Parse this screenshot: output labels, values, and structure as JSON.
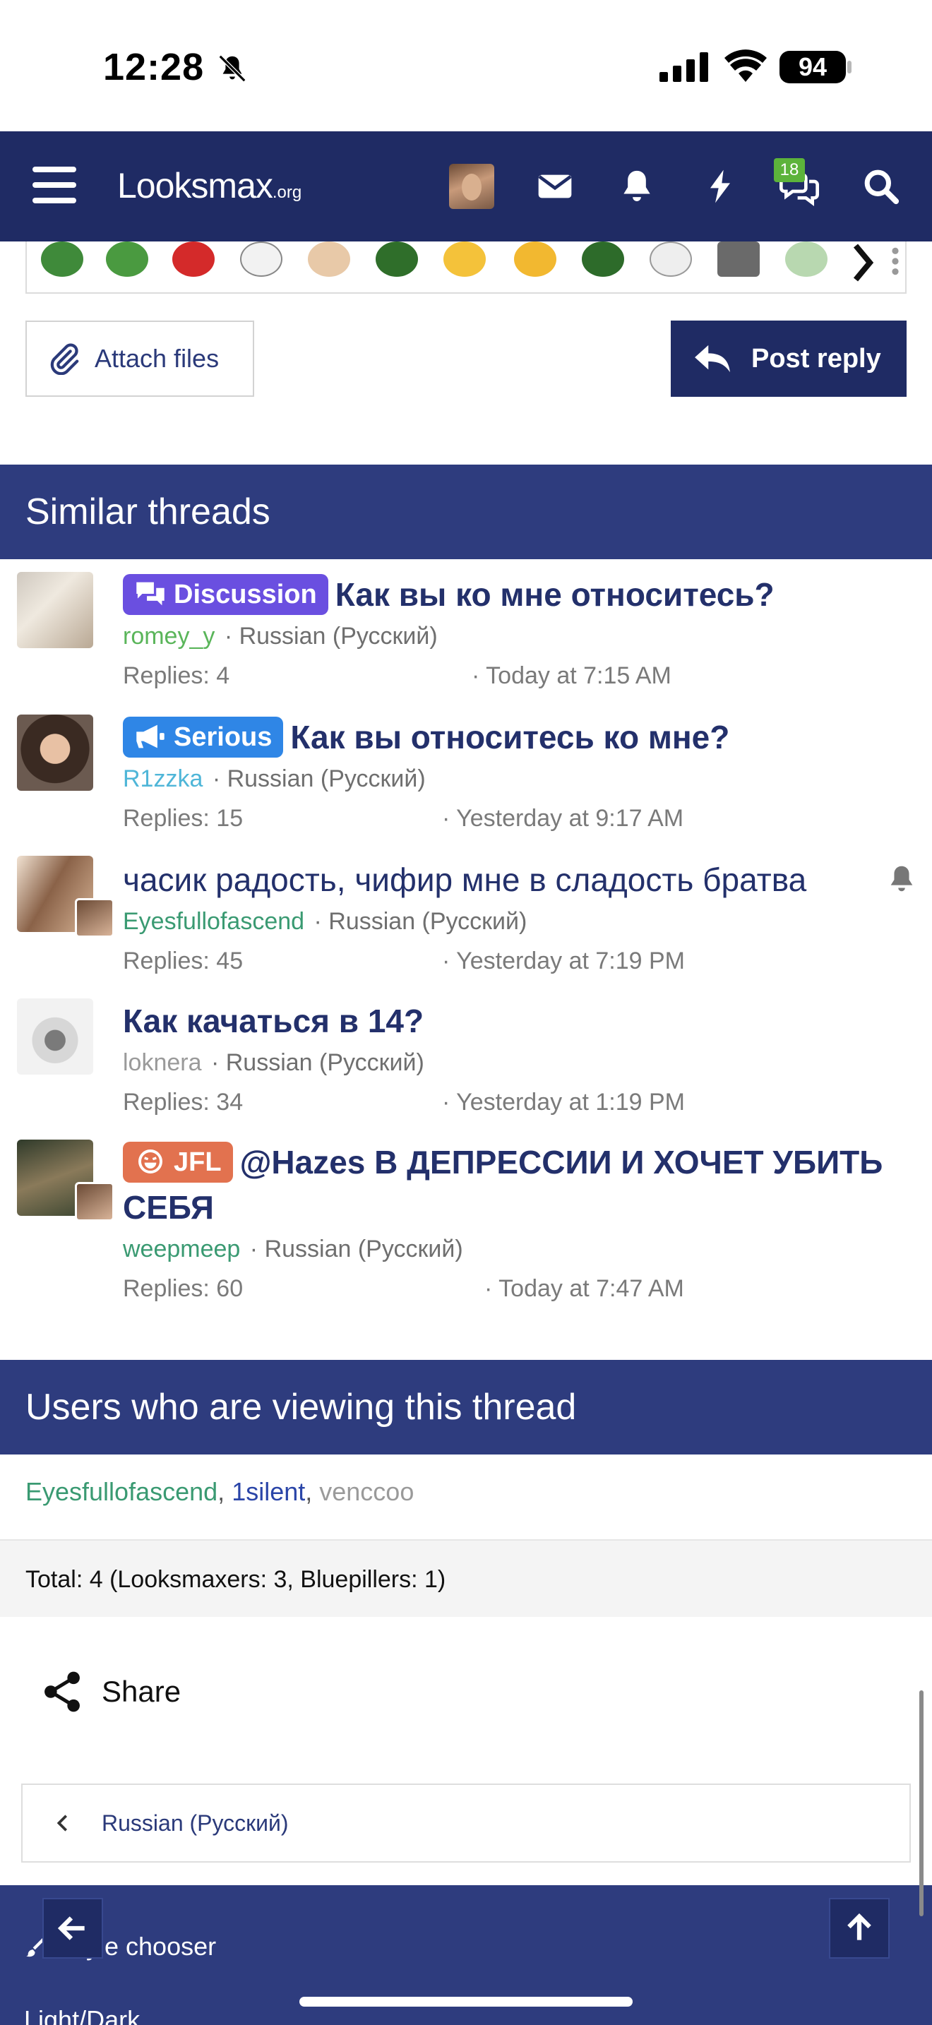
{
  "status": {
    "time": "12:28",
    "battery": "94"
  },
  "navbar": {
    "logo_main": "Looksmax",
    "logo_suffix": ".org",
    "conversations_badge": "18"
  },
  "actions": {
    "attach_label": "Attach files",
    "reply_label": "Post reply"
  },
  "similar": {
    "heading": "Similar threads",
    "threads": [
      {
        "prefix": "Discussion",
        "title": "Как вы ко мне относитесь?",
        "author": "romey_y",
        "forum": "Russian (Русский)",
        "replies": "Replies: 4",
        "date": "· Today at 7:15 AM"
      },
      {
        "prefix": "Serious",
        "title": "Как вы относитесь ко мне?",
        "author": "R1zzka",
        "forum": "Russian (Русский)",
        "replies": "Replies: 15",
        "date": "· Yesterday at 9:17 AM"
      },
      {
        "prefix": "",
        "title": "часик радость, чифир мне в сладость братва",
        "author": "Eyesfullofascend",
        "forum": "Russian (Русский)",
        "replies": "Replies: 45",
        "date": "· Yesterday at 7:19 PM"
      },
      {
        "prefix": "",
        "title": "Как качаться в 14?",
        "author": "loknera",
        "forum": "Russian (Русский)",
        "replies": "Replies: 34",
        "date": "· Yesterday at 1:19 PM"
      },
      {
        "prefix": "JFL",
        "title": "@Hazes В ДЕПРЕССИИ И ХОЧЕТ УБИТЬ СЕБЯ",
        "author": "weepmeep",
        "forum": "Russian (Русский)",
        "replies": "Replies: 60",
        "date": "· Today at 7:47 AM"
      }
    ]
  },
  "viewers": {
    "heading": "Users who are viewing this thread",
    "users": [
      "Eyesfullofascend",
      "1silent",
      "venccoo"
    ],
    "separator": ", ",
    "total": "Total: 4 (Looksmaxers: 3, Bluepillers: 1)"
  },
  "share_label": "Share",
  "breadcrumb_label": "Russian (Русский)",
  "footer": {
    "style_chooser": "Style chooser",
    "light_dark": "Light/Dark"
  },
  "colors": {
    "navbar": "#1f2b64",
    "section_header": "#2e3c7e",
    "discussion_prefix": "#6a4fe0",
    "serious_prefix": "#2f86e6",
    "jfl_prefix": "#e2724f",
    "title_text": "#23306b"
  }
}
